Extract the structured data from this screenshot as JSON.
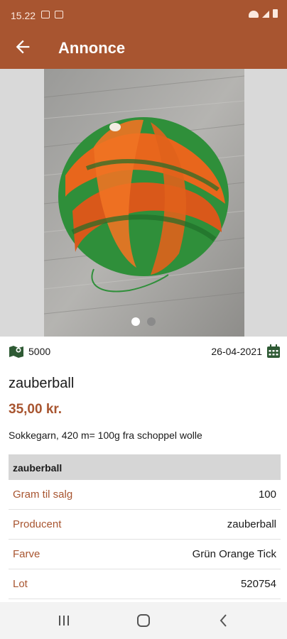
{
  "status_bar": {
    "time": "15.22"
  },
  "toolbar": {
    "title": "Annonce"
  },
  "gallery": {
    "active_index": 0,
    "count": 2
  },
  "meta": {
    "location": "5000",
    "date": "26-04-2021"
  },
  "ad": {
    "title": "zauberball",
    "price": "35,00 kr.",
    "description": "Sokkegarn, 420 m= 100g fra schoppel wolle"
  },
  "specs": {
    "header": "zauberball",
    "rows": [
      {
        "label": "Gram til salg",
        "value": "100"
      },
      {
        "label": "Producent",
        "value": "zauberball"
      },
      {
        "label": "Farve",
        "value": "Grün Orange Tick"
      },
      {
        "label": "Lot",
        "value": "520754"
      }
    ]
  },
  "colors": {
    "primary": "#a85530",
    "accent_green": "#2e5a34"
  },
  "icons": [
    "arrow-back-icon",
    "map-icon",
    "calendar-icon",
    "recents-icon",
    "home-icon",
    "back-nav-icon"
  ]
}
